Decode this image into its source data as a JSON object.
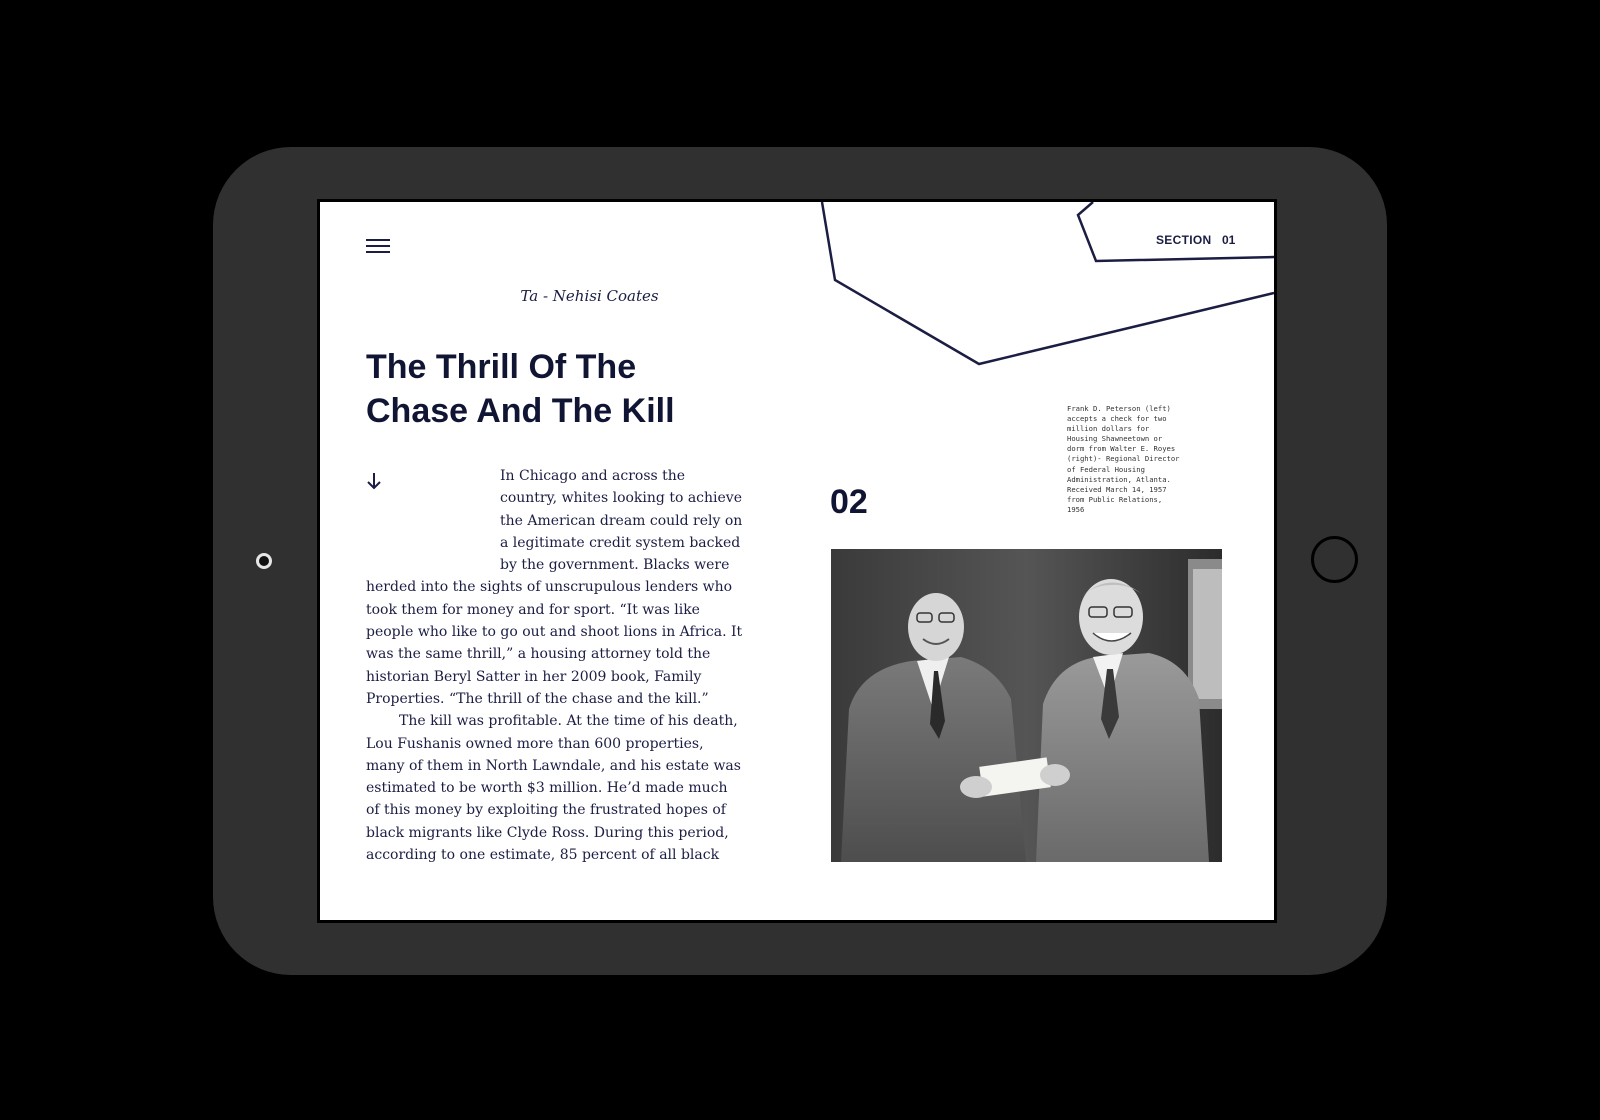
{
  "app": {
    "section_label": "SECTION",
    "section_number": "01"
  },
  "article": {
    "author": "Ta - Nehisi Coates",
    "title": "The Thrill Of The Chase And The Kill",
    "paragraphs": [
      "In Chicago and across the country, whites looking to achieve the American dream could rely on a legitimate credit system backed by the government. Blacks were herded into the sights of unscrupulous lenders who took them for money and for sport. “It was like people who like to go out and shoot lions in Africa. It was the same thrill,” a housing attorney told the historian Beryl Satter in her 2009 book, Family Properties. “The thrill of the chase and the kill.”",
      "The kill was profitable. At the time of his death, Lou Fushanis owned more than 600 properties, many of them in North Lawndale, and his estate was estimated to be worth $3 million. He’d made much of this money by exploiting the frustrated hopes of black migrants like Clyde Ross. During this period, according to one estimate, 85 percent of all black"
    ]
  },
  "figure": {
    "number": "02",
    "caption": "Frank D. Peterson (left) accepts a check for two million dollars for Housing Shawneetown or dorm from Walter E. Royes (right)- Regional Director of Federal Housing Administration, Atlanta. Received March 14, 1957 from Public Relations, 1956",
    "photo_description": "black-and-white photo"
  },
  "icons": {
    "menu": "hamburger-menu-icon",
    "scroll": "arrow-down-icon"
  },
  "colors": {
    "ink": "#1b1d43",
    "bezel": "#2f302f",
    "background": "#000000",
    "screen": "#ffffff"
  }
}
